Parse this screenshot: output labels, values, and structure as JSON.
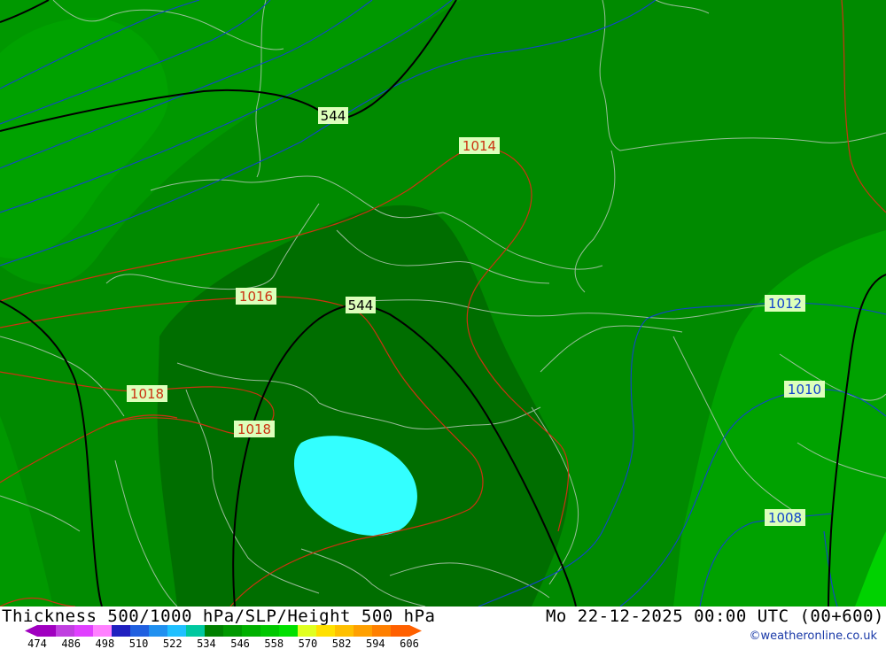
{
  "map": {
    "contour_labels": {
      "height_500": [
        "544",
        "544"
      ],
      "slp_red": [
        "1014",
        "1016",
        "1018",
        "1018"
      ],
      "slp_blue": [
        "1012",
        "1010",
        "1008"
      ]
    },
    "colors": {
      "field_dark": "#006e00",
      "field_mid": "#008a00",
      "field_light": "#00a200",
      "field_lighter": "#00bc00",
      "field_lightest": "#00d200",
      "cold_core": "#33ffff",
      "height_contour": "#000000",
      "slp_high_contour": "#cc3311",
      "slp_low_contour": "#1144cc",
      "borders": "#b4c8b4",
      "label_bg": "#ddffbb"
    }
  },
  "footer": {
    "title": "Thickness 500/1000 hPa/SLP/Height 500 hPa",
    "valid_time": "Mo 22-12-2025 00:00 UTC (00+600)",
    "credit": "©weatheronline.co.uk"
  },
  "legend": {
    "values": [
      "474",
      "486",
      "498",
      "510",
      "522",
      "534",
      "546",
      "558",
      "570",
      "582",
      "594",
      "606"
    ],
    "colors": [
      "#a000c0",
      "#c040e0",
      "#e040ff",
      "#ff80ff",
      "#2020c0",
      "#2060e0",
      "#2090f0",
      "#20c0ff",
      "#00c8a0",
      "#008000",
      "#009800",
      "#00b000",
      "#00c800",
      "#00e000",
      "#e0ff20",
      "#ffe000",
      "#ffc000",
      "#ffa000",
      "#ff8000",
      "#ff6000"
    ]
  }
}
